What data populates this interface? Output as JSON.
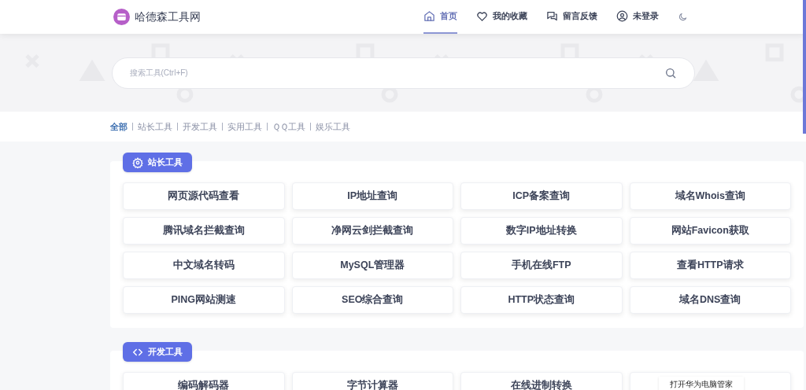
{
  "brand": {
    "name": "哈德森工具网"
  },
  "nav": [
    {
      "label": "首页",
      "kind": "home",
      "selected": true
    },
    {
      "label": "我的收藏",
      "kind": "favorites",
      "selected": false
    },
    {
      "label": "留言反馈",
      "kind": "feedback",
      "selected": false
    },
    {
      "label": "未登录",
      "kind": "account",
      "selected": false
    }
  ],
  "search": {
    "placeholder": "搜索工具(Ctrl+F)"
  },
  "categories": [
    {
      "label": "全部",
      "selected": true
    },
    {
      "label": "站长工具",
      "selected": false
    },
    {
      "label": "开发工具",
      "selected": false
    },
    {
      "label": "实用工具",
      "selected": false
    },
    {
      "label": "ＱＱ工具",
      "selected": false
    },
    {
      "label": "娱乐工具",
      "selected": false
    }
  ],
  "sections": [
    {
      "title": "站长工具",
      "kind": "webmaster",
      "tools": [
        "网页源代码查看",
        "IP地址查询",
        "ICP备案查询",
        "域名Whois查询",
        "腾讯域名拦截查询",
        "净网云剑拦截查询",
        "数字IP地址转换",
        "网站Favicon获取",
        "中文域名转码",
        "MySQL管理器",
        "手机在线FTP",
        "查看HTTP请求",
        "PING网站测速",
        "SEO综合查询",
        "HTTP状态查询",
        "域名DNS查询"
      ]
    },
    {
      "title": "开发工具",
      "kind": "developer",
      "tools": [
        "编码解码器",
        "字节计算器",
        "在线进制转换"
      ],
      "overlay_notice": "打开华为电脑管家"
    }
  ]
}
